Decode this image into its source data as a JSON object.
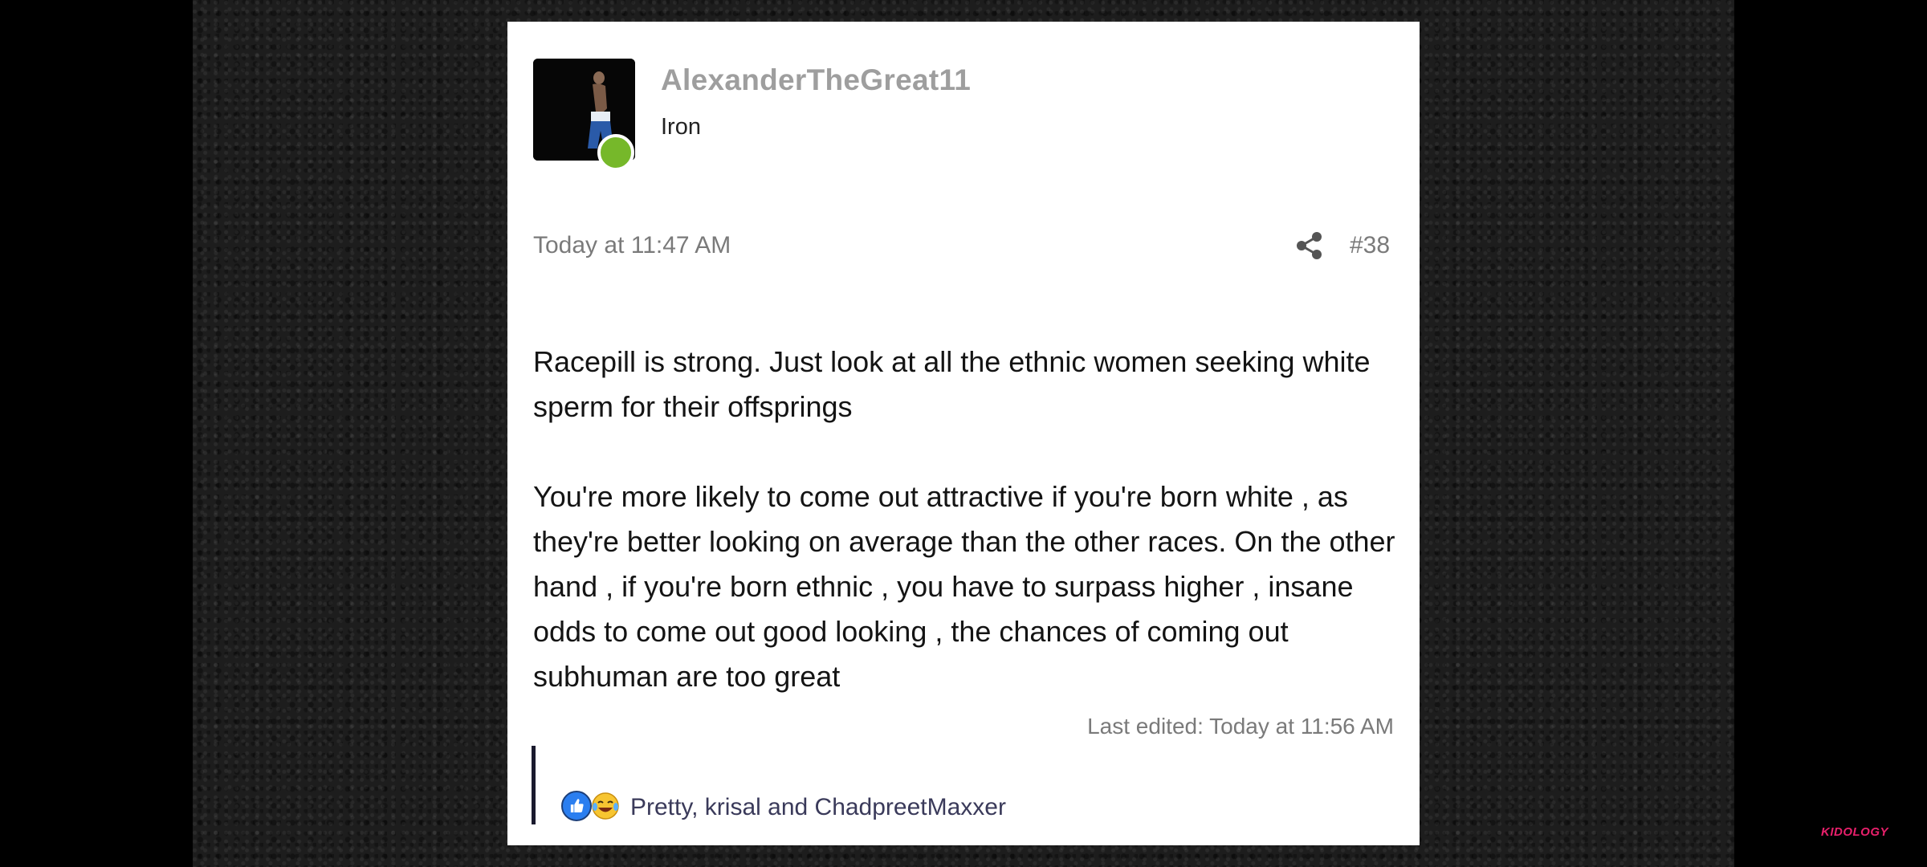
{
  "post": {
    "username": "AlexanderTheGreat11",
    "user_title": "Iron",
    "date": "Today at 11:47 AM",
    "post_number": "#38",
    "paragraphs": [
      "Racepill is strong. Just look at all the ethnic women seeking white sperm for their offsprings",
      "You're more likely to come out attractive if you're born white , as they're better looking on average than the other races. On the other hand , if you're born ethnic , you have to surpass higher , insane odds to come out good looking , the chances of coming out subhuman are too great"
    ],
    "last_edited": "Last edited: Today at 11:56 AM",
    "reactions": {
      "icons": [
        "like-icon",
        "laughing-emoji-icon"
      ],
      "reactors_text": "Pretty, krisal and ChadpreetMaxxer"
    }
  },
  "watermark": {
    "brand": "KIDOLOGY"
  },
  "colors": {
    "online": "#76b82a",
    "like": "#2a7ef0",
    "brand": "#e8206b"
  }
}
